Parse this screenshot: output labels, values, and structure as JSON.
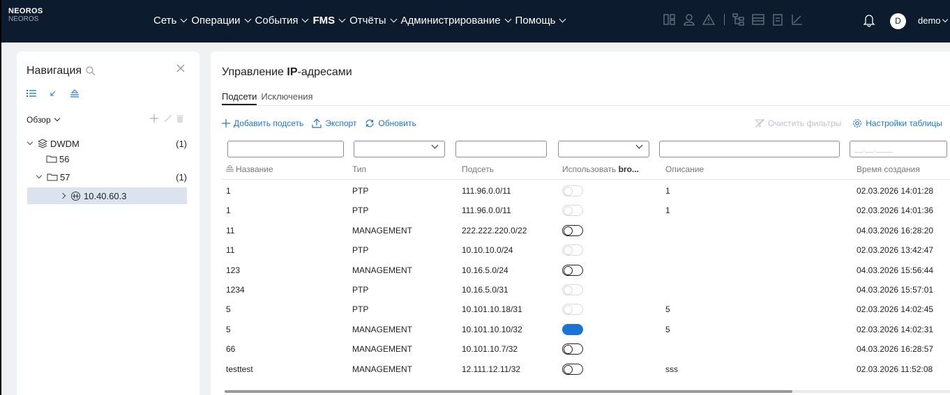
{
  "brand": {
    "name": "NEOROS",
    "sub": "NEOROS"
  },
  "menu": [
    {
      "label": "Сеть",
      "bold": false
    },
    {
      "label": "Операции",
      "bold": false
    },
    {
      "label": "События",
      "bold": false
    },
    {
      "label": "FMS",
      "bold": true
    },
    {
      "label": "Отчёты",
      "bold": false
    },
    {
      "label": "Администрирование",
      "bold": false
    },
    {
      "label": "Помощь",
      "bold": false
    }
  ],
  "user": {
    "avatar": "D",
    "name": "demo"
  },
  "nav": {
    "title": "Навигация",
    "view_select": "Обзор",
    "tree": [
      {
        "label": "DWDM",
        "count": "(1)"
      },
      {
        "label": "56",
        "count": ""
      },
      {
        "label": "57",
        "count": "(1)"
      },
      {
        "label": "10.40.60.3",
        "count": ""
      }
    ]
  },
  "main": {
    "title_prefix": "Управление ",
    "title_bold": "IP",
    "title_suffix": "-адресами",
    "tabs": [
      "Подсети",
      "Исключения"
    ],
    "actions": {
      "add": "Добавить подсеть",
      "export": "Экспорт",
      "refresh": "Обновить"
    },
    "clear_filters": "Очистить фильтры",
    "table_settings": "Настройки таблицы",
    "date_placeholder": "__.__.____",
    "columns": {
      "name": "Название",
      "type": "Тип",
      "subnet": "Подсеть",
      "broadcast_prefix": "Использовать ",
      "broadcast_bold": "bro...",
      "description": "Описание",
      "created": "Время создания"
    },
    "rows": [
      {
        "name": "1",
        "type": "PTP",
        "subnet": "111.96.0.0/11",
        "toggle": "disabled",
        "description": "1",
        "created": "02.03.2026 14:01:28"
      },
      {
        "name": "1",
        "type": "PTP",
        "subnet": "111.96.0.0/11",
        "toggle": "disabled",
        "description": "1",
        "created": "02.03.2026 14:01:36"
      },
      {
        "name": "11",
        "type": "MANAGEMENT",
        "subnet": "222.222.220.0/22",
        "toggle": "off",
        "description": "",
        "created": "04.03.2026 16:28:20"
      },
      {
        "name": "11",
        "type": "PTP",
        "subnet": "10.10.10.0/24",
        "toggle": "disabled",
        "description": "",
        "created": "02.03.2026 13:42:47"
      },
      {
        "name": "123",
        "type": "MANAGEMENT",
        "subnet": "10.16.5.0/24",
        "toggle": "off",
        "description": "",
        "created": "04.03.2026 15:56:44"
      },
      {
        "name": "1234",
        "type": "PTP",
        "subnet": "10.16.5.0/31",
        "toggle": "disabled",
        "description": "",
        "created": "04.03.2026 15:57:01"
      },
      {
        "name": "5",
        "type": "PTP",
        "subnet": "10.101.10.18/31",
        "toggle": "disabled",
        "description": "5",
        "created": "02.03.2026 14:02:45"
      },
      {
        "name": "5",
        "type": "MANAGEMENT",
        "subnet": "10.101.10.10/32",
        "toggle": "on",
        "description": "5",
        "created": "02.03.2026 14:02:31"
      },
      {
        "name": "66",
        "type": "MANAGEMENT",
        "subnet": "10.101.10.7/32",
        "toggle": "off",
        "description": "",
        "created": "04.03.2026 16:28:57"
      },
      {
        "name": "testtest",
        "type": "MANAGEMENT",
        "subnet": "12.111.12.11/32",
        "toggle": "off",
        "description": "sss",
        "created": "02.03.2026 11:52:08"
      }
    ],
    "scroll_fraction": 0.78
  },
  "colors": {
    "topbar": "#0d1b2e",
    "accent": "#1a73d6",
    "selected_row": "#dbe4ee"
  }
}
